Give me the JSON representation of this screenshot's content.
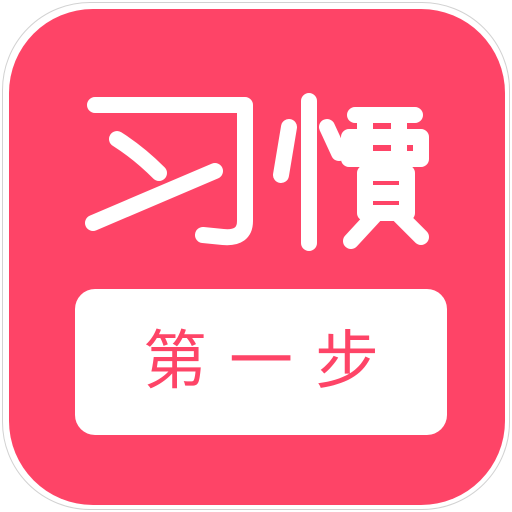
{
  "app_icon": {
    "title": "习惯",
    "subtitle": "第一步",
    "colors": {
      "background": "#fe4467",
      "badge": "#ffffff",
      "title_text": "#ffffff",
      "subtitle_text": "#fe4467",
      "frame_border": "#d2d2d2"
    }
  }
}
